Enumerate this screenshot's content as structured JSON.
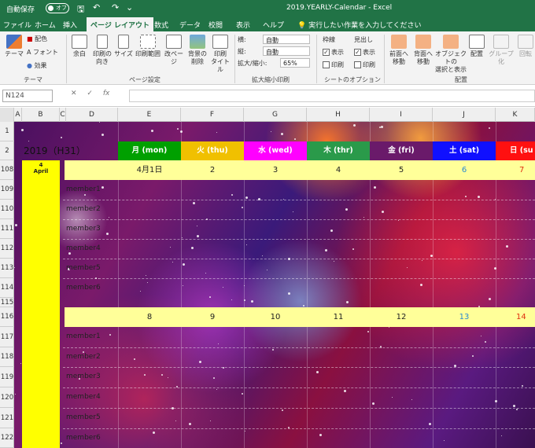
{
  "titlebar": {
    "autosave": "自動保存",
    "toggle": "オフ",
    "document_title": "2019.YEARLY-Calendar  -  Excel"
  },
  "tabs": {
    "items": [
      "ファイル",
      "ホーム",
      "挿入",
      "ページ レイアウト",
      "数式",
      "データ",
      "校閲",
      "表示",
      "ヘルプ"
    ],
    "active": "ページ レイアウト",
    "help_search": "実行したい作業を入力してください"
  },
  "ribbon": {
    "theme": {
      "themes": "テーマ",
      "colors": "配色",
      "fonts": "フォント",
      "effects": "効果",
      "group": "テーマ"
    },
    "page_setup": {
      "margins": "余白",
      "orientation": "印刷の\n向き",
      "size": "サイズ",
      "print_area": "印刷範囲",
      "breaks": "改ページ",
      "background": "背景の\n削除",
      "print_titles": "印刷\nタイトル",
      "group": "ページ設定"
    },
    "scale": {
      "width_label": "横:",
      "width_value": "自動",
      "height_label": "縦:",
      "height_value": "自動",
      "scale_label": "拡大/縮小:",
      "scale_value": "65%",
      "group": "拡大縮小印刷"
    },
    "sheet_options": {
      "gridlines": "枠線",
      "headings": "見出し",
      "view": "表示",
      "print": "印刷",
      "group": "シートのオプション"
    },
    "arrange": {
      "bring_forward": "前面へ\n移動",
      "send_backward": "背面へ\n移動",
      "selection_pane": "オブジェクトの\n選択と表示",
      "align": "配置",
      "group_btn": "グループ化",
      "rotate": "回転",
      "group": "配置"
    }
  },
  "formula_bar": {
    "name_box": "N124",
    "fx": "fx",
    "cancel": "✕",
    "enter": "✓",
    "content": ""
  },
  "sheet": {
    "columns": [
      "A",
      "B",
      "C",
      "D",
      "E",
      "F",
      "G",
      "H",
      "I",
      "J",
      "K"
    ],
    "rows": [
      "1",
      "2",
      "108",
      "109",
      "110",
      "111",
      "112",
      "113",
      "114",
      "115",
      "116",
      "117",
      "118",
      "119",
      "120",
      "121",
      "122"
    ],
    "year_label": "2019（H31）",
    "days": [
      {
        "label": "月 (mon)",
        "bg": "#00a000",
        "fg": "#ffffff"
      },
      {
        "label": "火 (thu)",
        "bg": "#f0c000",
        "fg": "#ffffff"
      },
      {
        "label": "水 (wed)",
        "bg": "#ff00ff",
        "fg": "#ffffff"
      },
      {
        "label": "木 (thr)",
        "bg": "#2a9a4a",
        "fg": "#ffffff"
      },
      {
        "label": "金 (fri)",
        "bg": "#6a1a6a",
        "fg": "#ffffff"
      },
      {
        "label": "土 (sat)",
        "bg": "#1010ff",
        "fg": "#ffffff"
      },
      {
        "label": "日 (su",
        "bg": "#ff1010",
        "fg": "#ffffff"
      }
    ],
    "week1_dates": [
      {
        "v": "4月1日",
        "c": "#222"
      },
      {
        "v": "2",
        "c": "#222"
      },
      {
        "v": "3",
        "c": "#222"
      },
      {
        "v": "4",
        "c": "#222"
      },
      {
        "v": "5",
        "c": "#222"
      },
      {
        "v": "6",
        "c": "#2a8ad0"
      },
      {
        "v": "7",
        "c": "#e03010"
      }
    ],
    "week2_dates": [
      {
        "v": "8",
        "c": "#222"
      },
      {
        "v": "9",
        "c": "#222"
      },
      {
        "v": "10",
        "c": "#222"
      },
      {
        "v": "11",
        "c": "#222"
      },
      {
        "v": "12",
        "c": "#222"
      },
      {
        "v": "13",
        "c": "#2a8ad0"
      },
      {
        "v": "14",
        "c": "#e03010"
      }
    ],
    "month_num": "4",
    "month_name": "April",
    "members_week1": [
      "member1",
      "member2",
      "member3",
      "member4",
      "member5",
      "member6"
    ],
    "members_week2": [
      "member1",
      "member2",
      "member3",
      "member4",
      "member5",
      "member6"
    ]
  }
}
